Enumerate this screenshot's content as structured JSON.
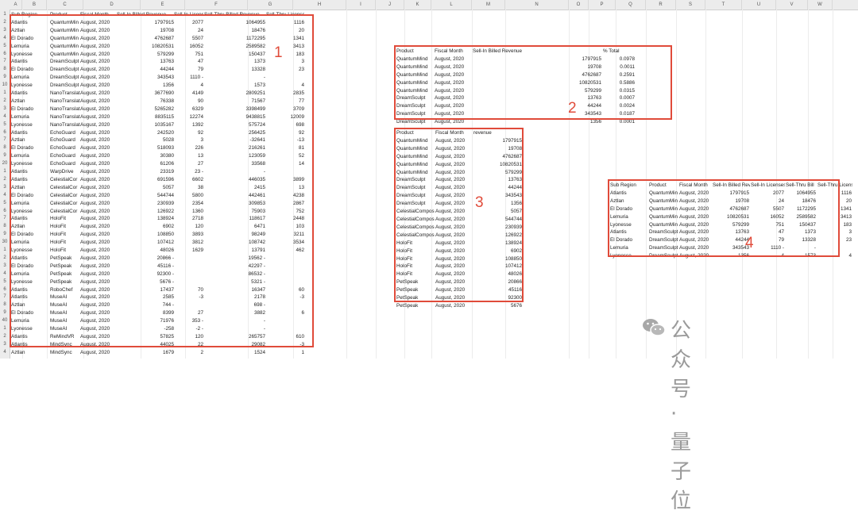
{
  "column_letters": [
    "A",
    "B",
    "C",
    "D",
    "E",
    "F",
    "G",
    "H",
    "I",
    "J",
    "K",
    "L",
    "M",
    "N",
    "O",
    "P",
    "Q",
    "R",
    "S",
    "T",
    "U",
    "V",
    "W"
  ],
  "sheet": {
    "headers": [
      "Sub Region",
      "Product",
      "Fiscal Month",
      "Sell-In Billed Revenue",
      "Sell-In Licenses",
      "Sell-Thru Billed Revenue",
      "Sell-Thru Licenses"
    ],
    "rows": [
      [
        "Atlantis",
        "QuantumMin",
        "August, 2020",
        "1797915",
        "2077",
        "1064955",
        "1116"
      ],
      [
        "Aztlan",
        "QuantumMin",
        "August, 2020",
        "19708",
        "24",
        "18476",
        "20"
      ],
      [
        "El Dorado",
        "QuantumMin",
        "August, 2020",
        "4762687",
        "5507",
        "1172295",
        "1341"
      ],
      [
        "Lemuria",
        "QuantumMin",
        "August, 2020",
        "10820531",
        "16052",
        "2589582",
        "3413"
      ],
      [
        "Lyonesse",
        "QuantumMin",
        "August, 2020",
        "579299",
        "751",
        "150437",
        "183"
      ],
      [
        "Atlantis",
        "DreamSculpt",
        "August, 2020",
        "13763",
        "47",
        "1373",
        "3"
      ],
      [
        "El Dorado",
        "DreamSculpt",
        "August, 2020",
        "44244",
        "79",
        "13328",
        "23"
      ],
      [
        "Lemuria",
        "DreamSculpt",
        "August, 2020",
        "343543",
        "1110 -",
        "-",
        ""
      ],
      [
        "Lyonesse",
        "DreamSculpt",
        "August, 2020",
        "1356",
        "4",
        "1573",
        "4"
      ],
      [
        "Atlantis",
        "NanoTranslat",
        "August, 2020",
        "3677690",
        "4149",
        "2809251",
        "2835"
      ],
      [
        "Aztlan",
        "NanoTranslat",
        "August, 2020",
        "76338",
        "90",
        "71567",
        "77"
      ],
      [
        "El Dorado",
        "NanoTranslat",
        "August, 2020",
        "5265282",
        "6329",
        "3398499",
        "3709"
      ],
      [
        "Lemuria",
        "NanoTranslat",
        "August, 2020",
        "8835115",
        "12274",
        "9438815",
        "12009"
      ],
      [
        "Lyonesse",
        "NanoTranslat",
        "August, 2020",
        "1035167",
        "1392",
        "575724",
        "698"
      ],
      [
        "Atlantis",
        "EchoGuard",
        "August, 2020",
        "242520",
        "92",
        "256425",
        "92"
      ],
      [
        "Aztlan",
        "EchoGuard",
        "August, 2020",
        "5028",
        "3",
        "-32641",
        "-13"
      ],
      [
        "El Dorado",
        "EchoGuard",
        "August, 2020",
        "518093",
        "226",
        "216261",
        "81"
      ],
      [
        "Lemuria",
        "EchoGuard",
        "August, 2020",
        "30380",
        "13",
        "123059",
        "52"
      ],
      [
        "Lyonesse",
        "EchoGuard",
        "August, 2020",
        "61206",
        "27",
        "33568",
        "14"
      ],
      [
        "Atlantis",
        "WarpDrive",
        "August, 2020",
        "23319",
        "23 -",
        "-",
        ""
      ],
      [
        "Atlantis",
        "CelestialCor",
        "August, 2020",
        "691596",
        "6602",
        "446035",
        "3899"
      ],
      [
        "Aztlan",
        "CelestialCor",
        "August, 2020",
        "5057",
        "38",
        "2415",
        "13"
      ],
      [
        "El Dorado",
        "CelestialCor",
        "August, 2020",
        "544744",
        "5800",
        "442461",
        "4238"
      ],
      [
        "Lemuria",
        "CelestialCor",
        "August, 2020",
        "230939",
        "2354",
        "309853",
        "2867"
      ],
      [
        "Lyonesse",
        "CelestialCor",
        "August, 2020",
        "126922",
        "1360",
        "75903",
        "752"
      ],
      [
        "Atlantis",
        "HoloFit",
        "August, 2020",
        "138924",
        "2718",
        "118617",
        "2448"
      ],
      [
        "Aztlan",
        "HoloFit",
        "August, 2020",
        "6902",
        "120",
        "6471",
        "103"
      ],
      [
        "El Dorado",
        "HoloFit",
        "August, 2020",
        "108850",
        "3893",
        "98249",
        "3211"
      ],
      [
        "Lemuria",
        "HoloFit",
        "August, 2020",
        "107412",
        "3812",
        "108742",
        "3534"
      ],
      [
        "Lyonesse",
        "HoloFit",
        "August, 2020",
        "48026",
        "1629",
        "13791",
        "462"
      ],
      [
        "Atlantis",
        "PetSpeak",
        "August, 2020",
        "20866 -",
        "",
        "19562 -",
        ""
      ],
      [
        "El Dorado",
        "PetSpeak",
        "August, 2020",
        "45116 -",
        "",
        "42297 -",
        ""
      ],
      [
        "Lemuria",
        "PetSpeak",
        "August, 2020",
        "92300 -",
        "",
        "86532 -",
        ""
      ],
      [
        "Lyonesse",
        "PetSpeak",
        "August, 2020",
        "5676 -",
        "",
        "5321 -",
        ""
      ],
      [
        "Atlantis",
        "RoboChef",
        "August, 2020",
        "17437",
        "70",
        "16347",
        "60"
      ],
      [
        "Atlantis",
        "MuseAI",
        "August, 2020",
        "2585",
        "-3",
        "2178",
        "-3"
      ],
      [
        "Aztlan",
        "MuseAI",
        "August, 2020",
        "744 -",
        "",
        "698 -",
        ""
      ],
      [
        "El Dorado",
        "MuseAI",
        "August, 2020",
        "8399",
        "27",
        "3882",
        "6"
      ],
      [
        "Lemuria",
        "MuseAI",
        "August, 2020",
        "71976",
        "353 -",
        "-",
        ""
      ],
      [
        "Lyonesse",
        "MuseAI",
        "August, 2020",
        "-258",
        "-2 -",
        "-",
        ""
      ],
      [
        "Atlantis",
        "ReMindVR",
        "August, 2020",
        "57825",
        "120",
        "265757",
        "610"
      ],
      [
        "Atlantis",
        "MindSync",
        "August, 2020",
        "44025",
        "22",
        "29082",
        "-3"
      ],
      [
        "Aztlan",
        "MindSync",
        "August, 2020",
        "1679",
        "2",
        "1524",
        "1"
      ]
    ]
  },
  "table2": {
    "headers": [
      "Product",
      "Fiscal Month",
      "Sell-In Billed Revenue",
      "% Total"
    ],
    "rows": [
      [
        "QuantumMind",
        "August, 2020",
        "1797915",
        "0.0978"
      ],
      [
        "QuantumMind",
        "August, 2020",
        "19708",
        "0.0011"
      ],
      [
        "QuantumMind",
        "August, 2020",
        "4762687",
        "0.2591"
      ],
      [
        "QuantumMind",
        "August, 2020",
        "10820531",
        "0.5886"
      ],
      [
        "QuantumMind",
        "August, 2020",
        "579299",
        "0.0315"
      ],
      [
        "DreamSculpt",
        "August, 2020",
        "13763",
        "0.0007"
      ],
      [
        "DreamSculpt",
        "August, 2020",
        "44244",
        "0.0024"
      ],
      [
        "DreamSculpt",
        "August, 2020",
        "343543",
        "0.0187"
      ],
      [
        "DreamSculpt",
        "August, 2020",
        "1356",
        "0.0001"
      ]
    ]
  },
  "table3": {
    "headers": [
      "Product",
      "Fiscal Month",
      "revenue"
    ],
    "rows": [
      [
        "QuantumMind",
        "August, 2020",
        "1797915"
      ],
      [
        "QuantumMind",
        "August, 2020",
        "19708"
      ],
      [
        "QuantumMind",
        "August, 2020",
        "4762687"
      ],
      [
        "QuantumMind",
        "August, 2020",
        "10820531"
      ],
      [
        "QuantumMind",
        "August, 2020",
        "579299"
      ],
      [
        "DreamSculpt",
        "August, 2020",
        "13763"
      ],
      [
        "DreamSculpt",
        "August, 2020",
        "44244"
      ],
      [
        "DreamSculpt",
        "August, 2020",
        "343543"
      ],
      [
        "DreamSculpt",
        "August, 2020",
        "1356"
      ],
      [
        "CelestialCompos",
        "August, 2020",
        "5057"
      ],
      [
        "CelestialCompos",
        "August, 2020",
        "544744"
      ],
      [
        "CelestialCompos",
        "August, 2020",
        "230939"
      ],
      [
        "CelestialCompos",
        "August, 2020",
        "126922"
      ],
      [
        "HoloFit",
        "August, 2020",
        "138924"
      ],
      [
        "HoloFit",
        "August, 2020",
        "6902"
      ],
      [
        "HoloFit",
        "August, 2020",
        "108850"
      ],
      [
        "HoloFit",
        "August, 2020",
        "107412"
      ],
      [
        "HoloFit",
        "August, 2020",
        "48026"
      ],
      [
        "PetSpeak",
        "August, 2020",
        "20866"
      ],
      [
        "PetSpeak",
        "August, 2020",
        "45116"
      ],
      [
        "PetSpeak",
        "August, 2020",
        "92300"
      ],
      [
        "PetSpeak",
        "August, 2020",
        "5676"
      ]
    ]
  },
  "table4": {
    "headers": [
      "Sub Region",
      "Product",
      "Fiscal Month",
      "Sell-In Billed Rev",
      "Sell-In Licenses",
      "Sell-Thru Bill",
      "Sell-Thru Licenses"
    ],
    "rows": [
      [
        "Atlantis",
        "QuantumMin",
        "August, 2020",
        "1797915",
        "2077",
        "1064955",
        "1116"
      ],
      [
        "Aztlan",
        "QuantumMin",
        "August, 2020",
        "19708",
        "24",
        "18476",
        "20"
      ],
      [
        "El Dorado",
        "QuantumMin",
        "August, 2020",
        "4762687",
        "5507",
        "1172295",
        "1341"
      ],
      [
        "Lemuria",
        "QuantumMin",
        "August, 2020",
        "10820531",
        "16052",
        "2589582",
        "3413"
      ],
      [
        "Lyonesse",
        "QuantumMin",
        "August, 2020",
        "579299",
        "751",
        "150437",
        "183"
      ],
      [
        "Atlantis",
        "DreamSculpt",
        "August, 2020",
        "13763",
        "47",
        "1373",
        "3"
      ],
      [
        "El Dorado",
        "DreamSculpt",
        "August, 2020",
        "44244",
        "79",
        "13328",
        "23"
      ],
      [
        "Lemuria",
        "DreamSculpt",
        "August, 2020",
        "343543",
        "1110 -",
        "-",
        ""
      ],
      [
        "Lyonesse",
        "DreamSculpt",
        "August, 2020",
        "1356",
        "4",
        "1573",
        "4"
      ]
    ]
  },
  "annotations": {
    "box1": "1",
    "box2": "2",
    "box3": "3",
    "box4": "4"
  },
  "watermark": "公众号 · 量子位",
  "colors": {
    "annotation": "#e04b3a",
    "header_bg": "#ececec",
    "watermark": "#9a9a9a"
  }
}
